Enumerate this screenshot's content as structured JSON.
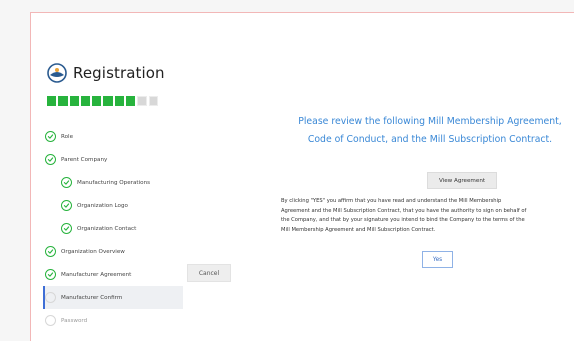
{
  "header": {
    "title": "Registration",
    "logo_icon": "registration-logo-icon"
  },
  "progress": {
    "completed": 8,
    "total": 10,
    "color": "#27b33d"
  },
  "steps": [
    {
      "label": "Role",
      "status": "done"
    },
    {
      "label": "Parent Company",
      "status": "done"
    },
    {
      "label": "Manufacturing Operations",
      "status": "done",
      "sub": true
    },
    {
      "label": "Organization Logo",
      "status": "done",
      "sub": true
    },
    {
      "label": "Organization Contact",
      "status": "done",
      "sub": true
    },
    {
      "label": "Organization Overview",
      "status": "done"
    },
    {
      "label": "Manufacturer Agreement",
      "status": "done"
    },
    {
      "label": "Manufacturer Confirm",
      "status": "active"
    },
    {
      "label": "Password",
      "status": "pending"
    }
  ],
  "buttons": {
    "cancel": "Cancel",
    "view_agreement": "View Agreement",
    "yes": "Yes"
  },
  "content": {
    "heading_line1": "Please review the following Mill Membership Agreement,",
    "heading_line2": "Code of Conduct, and the Mill Subscription Contract.",
    "consent_line1": "By clicking \"YES\" you affirm that you have read and understand the Mill Membership",
    "consent_line2": "Agreement and the Mill Subscription Contract, that you have the authority to sign on behalf of",
    "consent_line3": "the Company, and that by your signature you intend to bind the Company to the terms of the",
    "consent_line4": "Mill Membership Agreement and Mill Subscription Contract."
  },
  "colors": {
    "accent": "#3a88d6",
    "success": "#27b33d",
    "active_border": "#3e6ed6"
  }
}
